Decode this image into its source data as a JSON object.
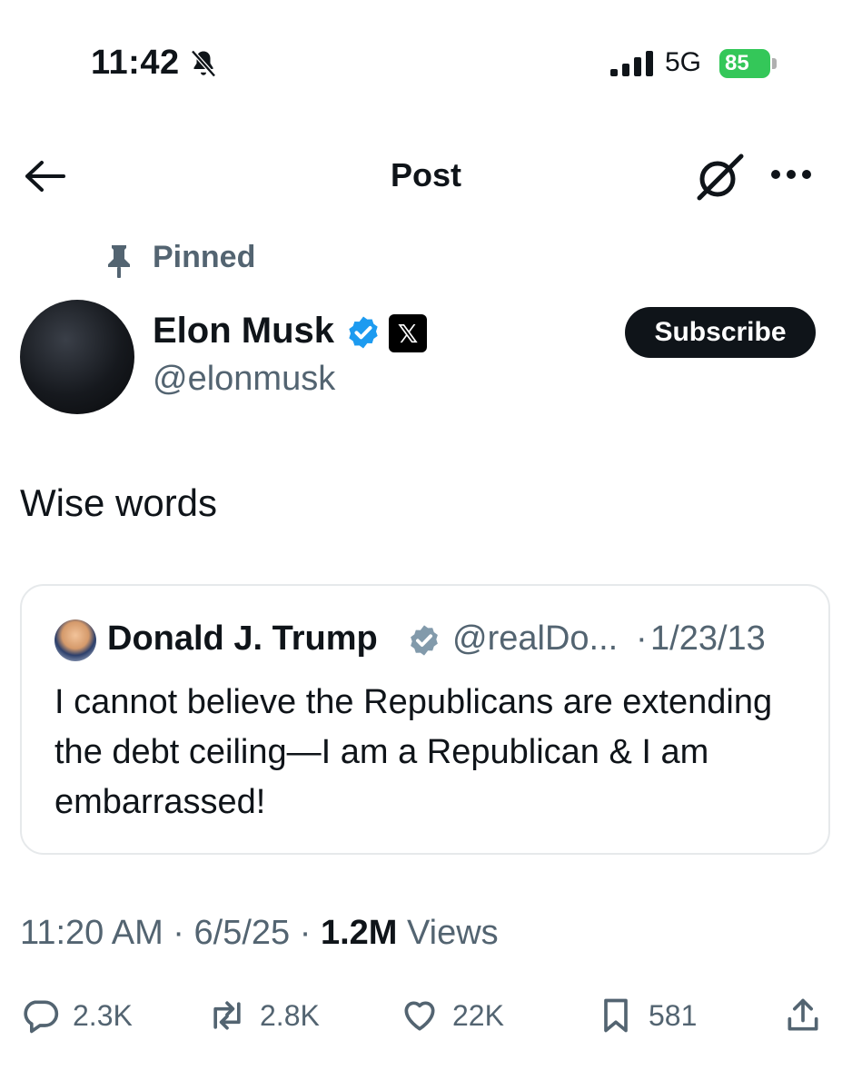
{
  "status_bar": {
    "time": "11:42",
    "network": "5G",
    "battery": "85"
  },
  "header": {
    "title": "Post"
  },
  "pinned": {
    "label": "Pinned"
  },
  "author": {
    "name": "Elon Musk",
    "handle": "@elonmusk",
    "x_badge": "𝕏"
  },
  "subscribe_label": "Subscribe",
  "post": {
    "text": "Wise words"
  },
  "quote": {
    "name": "Donald J. Trump",
    "handle": "@realDo...",
    "separator": "·",
    "date": "1/23/13",
    "text": "I cannot believe the Republicans are extending the debt ceiling—I am a Republican & I am embarrassed!"
  },
  "meta": {
    "time": "11:20 AM",
    "date": "6/5/25",
    "views_count": "1.2M",
    "views_label": "Views"
  },
  "actions": {
    "replies": "2.3K",
    "reposts": "2.8K",
    "likes": "22K",
    "bookmarks": "581"
  },
  "colors": {
    "accent_blue": "#1d9bf0",
    "battery_green": "#34c759",
    "secondary_text": "#536471"
  }
}
